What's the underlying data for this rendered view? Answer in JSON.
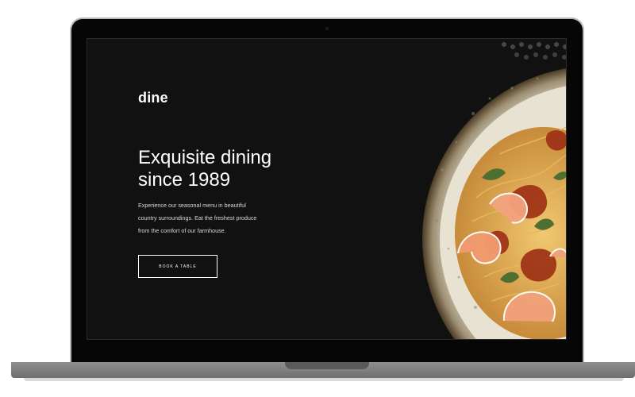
{
  "site": {
    "logo": "dine",
    "hero": {
      "headline_line1": "Exquisite dining",
      "headline_line2": "since 1989",
      "intro_line1": "Experience our seasonal menu in beautiful",
      "intro_line2": "country surroundings. Eat the freshest produce",
      "intro_line3": "from the comfort of our farmhouse.",
      "cta_label": "BOOK A TABLE"
    },
    "image": {
      "icon": "pasta-dish-photo-icon"
    }
  },
  "colors": {
    "background": "#111111",
    "text": "#ffffff",
    "laptop_frame": "#060606",
    "laptop_base": "#8a8a8a"
  }
}
